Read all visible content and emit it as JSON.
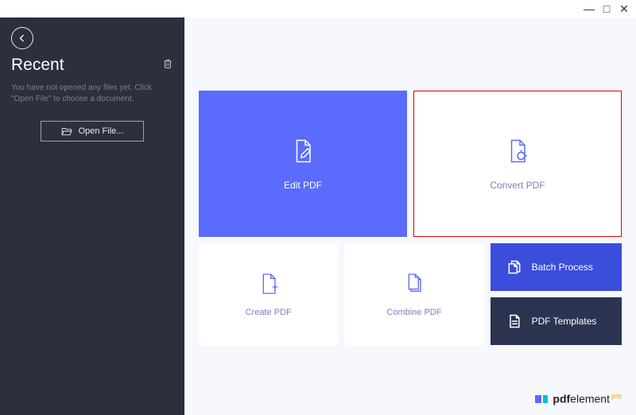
{
  "window": {
    "minimize": "—",
    "maximize": "□",
    "close": "✕"
  },
  "sidebar": {
    "recent_title": "Recent",
    "hint": "You have not opened any files yet. Click \"Open File\" to choose a document.",
    "open_file_label": "Open File..."
  },
  "tiles": {
    "edit": "Edit PDF",
    "convert": "Convert PDF",
    "create": "Create PDF",
    "combine": "Combine PDF",
    "batch": "Batch Process",
    "templates": "PDF Templates"
  },
  "brand": {
    "prefix": "pdf",
    "suffix": "element",
    "tag": "pro"
  }
}
